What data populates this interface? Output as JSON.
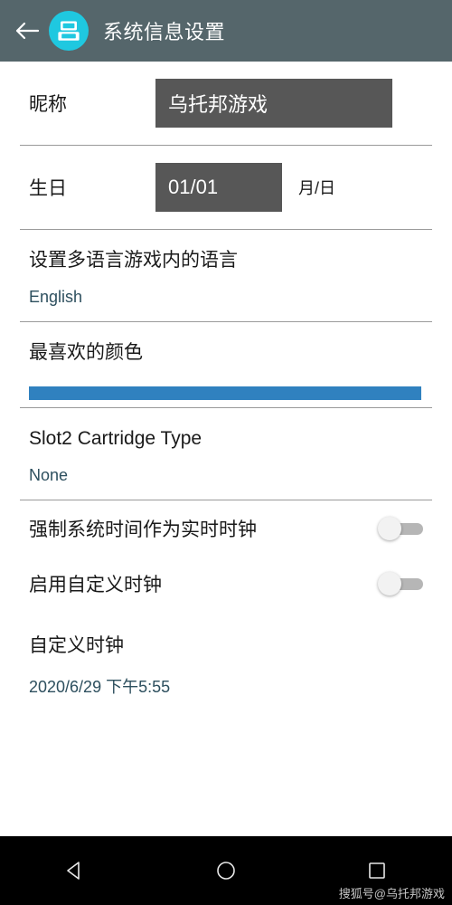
{
  "header": {
    "back_icon": "arrow-left-icon",
    "app_icon": "nintendo-ds-icon",
    "title": "系统信息设置"
  },
  "form": {
    "nickname": {
      "label": "昵称",
      "value": "乌托邦游戏"
    },
    "birthday": {
      "label": "生日",
      "value": "01/01",
      "suffix": "月/日"
    }
  },
  "settings": [
    {
      "title": "设置多语言游戏内的语言",
      "value": "English"
    },
    {
      "title": "最喜欢的颜色",
      "value": ""
    },
    {
      "title": "Slot2 Cartridge Type",
      "value": "None"
    }
  ],
  "language_setting": {
    "title": "设置多语言游戏内的语言",
    "value": "English"
  },
  "color_setting": {
    "title": "最喜欢的颜色",
    "color": "#3081bf"
  },
  "slot2_setting": {
    "title": "Slot2 Cartridge Type",
    "value": "None"
  },
  "toggles": [
    {
      "label": "强制系统时间作为实时时钟",
      "state": "off"
    },
    {
      "label": "启用自定义时钟",
      "state": "off"
    }
  ],
  "clock_setting": {
    "title": "自定义时钟",
    "value": "2020/6/29  下午5:55"
  },
  "navbar": {
    "back": "triangle-back-icon",
    "home": "circle-home-icon",
    "recents": "square-recents-icon"
  },
  "watermark": "搜狐号@乌托邦游戏",
  "theme": {
    "appbar_bg": "#55666b",
    "app_icon_bg": "#1fc8e0",
    "input_bg": "#575757",
    "accent_blue": "#3081bf",
    "value_text": "#2d4f5e"
  }
}
